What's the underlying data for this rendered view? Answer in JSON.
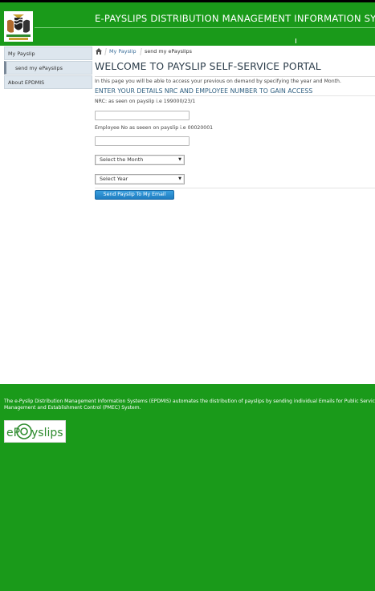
{
  "header": {
    "title": "E-PAYSLIPS DISTRIBUTION MANAGEMENT INFORMATION SYSTEM",
    "logo_icon": "coat-of-arms"
  },
  "sidebar": {
    "items": [
      {
        "label": "My Payslip"
      },
      {
        "label": "send my ePayslips"
      },
      {
        "label": "About EPDMIS"
      }
    ]
  },
  "breadcrumb": {
    "home_icon": "home-icon",
    "items": [
      "My Payslip",
      "send my ePayslips"
    ]
  },
  "main": {
    "heading": "WELCOME TO PAYSLIP SELF-SERVICE PORTAL",
    "intro": "In this page you will be able to access your previous on demand by specifying the year and Month.",
    "subheading": "ENTER YOUR DETAILS NRC AND EMPLOYEE NUMBER TO GAIN ACCESS",
    "nrc_label": "NRC:  as seen on payslip i.e 199000/23/1",
    "nrc_value": "",
    "employee_label": "Employee No as seeen on payslip i.e 00020001",
    "employee_value": "",
    "month_select": "Select the Month",
    "year_select": "Select Year",
    "submit_label": "Send Payslip To My Email"
  },
  "footer": {
    "text": "The e-Pyslip Distribution Management Information Systems (EPDMIS) automates the distribution of payslips by sending individual Emails for Public Service Management and Establishment Control (PMEC) System.",
    "logo_text": "ePayslips"
  },
  "colors": {
    "brand_green": "#1a9a1a",
    "link_blue": "#3a6e99",
    "button_blue": "#1e7cc0"
  }
}
